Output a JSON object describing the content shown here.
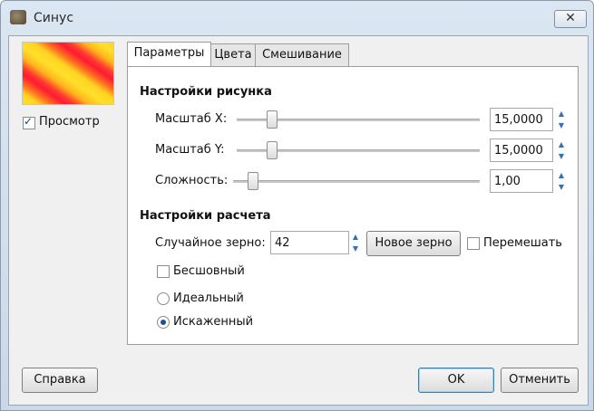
{
  "window": {
    "title": "Синус",
    "close_glyph": "✕"
  },
  "preview": {
    "checkbox_checked": true,
    "label": "Просмотр"
  },
  "tabs": [
    {
      "label": "Параметры",
      "active": true
    },
    {
      "label": "Цвета",
      "active": false
    },
    {
      "label": "Смешивание",
      "active": false
    }
  ],
  "drawing_settings": {
    "heading": "Настройки рисунка",
    "scale_x": {
      "label": "Масштаб X:",
      "value": "15,0000"
    },
    "scale_y": {
      "label": "Масштаб Y:",
      "value": "15,0000"
    },
    "complexity": {
      "label": "Сложность:",
      "value": "1,00"
    }
  },
  "calc_settings": {
    "heading": "Настройки расчета",
    "seed_label": "Случайное зерно:",
    "seed_value": "42",
    "new_seed_button": "Новое зерно",
    "shuffle_label": "Перемешать",
    "shuffle_checked": false,
    "seamless_label": "Бесшовный",
    "seamless_checked": false,
    "ideal_label": "Идеальный",
    "distorted_label": "Искаженный",
    "selected_option": "distorted"
  },
  "buttons": {
    "help": "Справка",
    "ok": "OK",
    "cancel": "Отменить"
  }
}
